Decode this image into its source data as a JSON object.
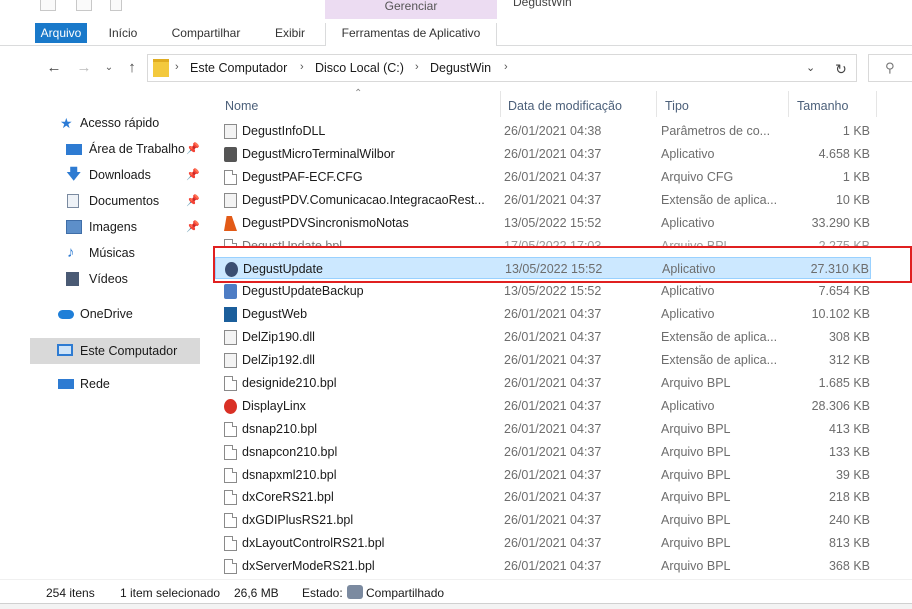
{
  "window": {
    "title": "DegustWin",
    "contextual_header": "Gerenciar"
  },
  "ribbon": {
    "tabs": [
      {
        "label": "Arquivo"
      },
      {
        "label": "Início"
      },
      {
        "label": "Compartilhar"
      },
      {
        "label": "Exibir"
      },
      {
        "label": "Ferramentas de Aplicativo"
      }
    ]
  },
  "address": {
    "crumbs": [
      "Este Computador",
      "Disco Local (C:)",
      "DegustWin"
    ],
    "search_placeholder": ""
  },
  "sidebar": {
    "items": [
      {
        "label": "Acesso rápido",
        "icon": "star-icon",
        "pinned": false
      },
      {
        "label": "Área de Trabalho",
        "icon": "desktop-icon",
        "pinned": true
      },
      {
        "label": "Downloads",
        "icon": "download-icon",
        "pinned": true
      },
      {
        "label": "Documentos",
        "icon": "documents-icon",
        "pinned": true
      },
      {
        "label": "Imagens",
        "icon": "pictures-icon",
        "pinned": true
      },
      {
        "label": "Músicas",
        "icon": "music-icon",
        "pinned": false
      },
      {
        "label": "Vídeos",
        "icon": "videos-icon",
        "pinned": false
      },
      {
        "label": "OneDrive",
        "icon": "cloud-icon",
        "pinned": false
      },
      {
        "label": "Este Computador",
        "icon": "computer-icon",
        "pinned": false,
        "selected": true
      },
      {
        "label": "Rede",
        "icon": "network-icon",
        "pinned": false
      }
    ]
  },
  "columns": {
    "name": "Nome",
    "date": "Data de modificação",
    "type": "Tipo",
    "size": "Tamanho"
  },
  "files": [
    {
      "name": "DegustInfoDLL",
      "date": "26/01/2021 04:38",
      "type": "Parâmetros de co...",
      "size": "1 KB",
      "icon": "settings-file-icon"
    },
    {
      "name": "DegustMicroTerminalWilbor",
      "date": "26/01/2021 04:37",
      "type": "Aplicativo",
      "size": "4.658 KB",
      "icon": "application-icon"
    },
    {
      "name": "DegustPAF-ECF.CFG",
      "date": "26/01/2021 04:37",
      "type": "Arquivo CFG",
      "size": "1 KB",
      "icon": "file-icon"
    },
    {
      "name": "DegustPDV.Comunicacao.IntegracaoRest...",
      "date": "26/01/2021 04:37",
      "type": "Extensão de aplica...",
      "size": "10 KB",
      "icon": "dll-icon"
    },
    {
      "name": "DegustPDVSincronismoNotas",
      "date": "13/05/2022 15:52",
      "type": "Aplicativo",
      "size": "33.290 KB",
      "icon": "application-icon"
    },
    {
      "name": "DegustUpdate.bpl",
      "date": "17/05/2022 17:03",
      "type": "Arquivo BPL",
      "size": "2.275 KB",
      "icon": "file-icon"
    },
    {
      "name": "DegustUpdate",
      "date": "13/05/2022 15:52",
      "type": "Aplicativo",
      "size": "27.310 KB",
      "icon": "application-icon",
      "selected": true
    },
    {
      "name": "DegustUpdateBackup",
      "date": "13/05/2022 15:52",
      "type": "Aplicativo",
      "size": "7.654 KB",
      "icon": "application-icon"
    },
    {
      "name": "DegustWeb",
      "date": "26/01/2021 04:37",
      "type": "Aplicativo",
      "size": "10.102 KB",
      "icon": "application-icon"
    },
    {
      "name": "DelZip190.dll",
      "date": "26/01/2021 04:37",
      "type": "Extensão de aplica...",
      "size": "308 KB",
      "icon": "dll-icon"
    },
    {
      "name": "DelZip192.dll",
      "date": "26/01/2021 04:37",
      "type": "Extensão de aplica...",
      "size": "312 KB",
      "icon": "dll-icon"
    },
    {
      "name": "designide210.bpl",
      "date": "26/01/2021 04:37",
      "type": "Arquivo BPL",
      "size": "1.685 KB",
      "icon": "file-icon"
    },
    {
      "name": "DisplayLinx",
      "date": "26/01/2021 04:37",
      "type": "Aplicativo",
      "size": "28.306 KB",
      "icon": "application-icon"
    },
    {
      "name": "dsnap210.bpl",
      "date": "26/01/2021 04:37",
      "type": "Arquivo BPL",
      "size": "413 KB",
      "icon": "file-icon"
    },
    {
      "name": "dsnapcon210.bpl",
      "date": "26/01/2021 04:37",
      "type": "Arquivo BPL",
      "size": "133 KB",
      "icon": "file-icon"
    },
    {
      "name": "dsnapxml210.bpl",
      "date": "26/01/2021 04:37",
      "type": "Arquivo BPL",
      "size": "39 KB",
      "icon": "file-icon"
    },
    {
      "name": "dxCoreRS21.bpl",
      "date": "26/01/2021 04:37",
      "type": "Arquivo BPL",
      "size": "218 KB",
      "icon": "file-icon"
    },
    {
      "name": "dxGDIPlusRS21.bpl",
      "date": "26/01/2021 04:37",
      "type": "Arquivo BPL",
      "size": "240 KB",
      "icon": "file-icon"
    },
    {
      "name": "dxLayoutControlRS21.bpl",
      "date": "26/01/2021 04:37",
      "type": "Arquivo BPL",
      "size": "813 KB",
      "icon": "file-icon"
    },
    {
      "name": "dxServerModeRS21.bpl",
      "date": "26/01/2021 04:37",
      "type": "Arquivo BPL",
      "size": "368 KB",
      "icon": "file-icon"
    }
  ],
  "status": {
    "count": "254 itens",
    "selection": "1 item selecionado",
    "selection_size": "26,6 MB",
    "state_label": "Estado:",
    "state_value": "Compartilhado"
  },
  "colors": {
    "accent": "#1979ca",
    "selection_bg": "#cce8ff",
    "selection_border": "#99d1ff",
    "highlight": "#e02020"
  }
}
